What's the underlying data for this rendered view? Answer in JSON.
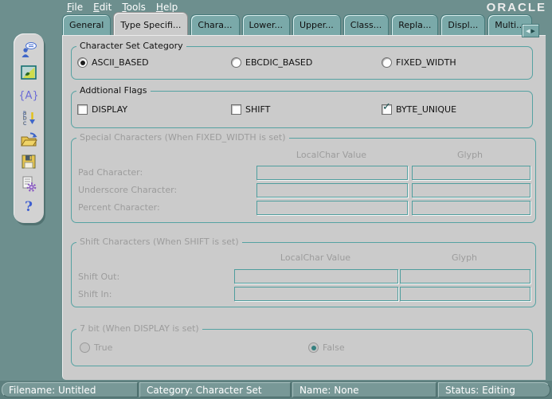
{
  "window": {
    "brand": "ORACLE"
  },
  "menu": {
    "items": [
      "File",
      "Edit",
      "Tools",
      "Help"
    ]
  },
  "tabs": [
    "General",
    "Type Specifi...",
    "Chara...",
    "Lower...",
    "Upper...",
    "Class...",
    "Repla...",
    "Displ...",
    "Multi..."
  ],
  "tab_scroll": {
    "left_arrow": "◀",
    "right_arrow": "▶"
  },
  "toolbar": {
    "icons": [
      "user-chat-icon",
      "image-icon",
      "braces-a-icon",
      "sort-abc-icon",
      "open-folder-icon",
      "save-icon",
      "settings-doc-icon",
      "help-icon"
    ]
  },
  "groups": {
    "charset_category": {
      "title": "Character Set Category",
      "options": [
        {
          "label": "ASCII_BASED",
          "selected": true
        },
        {
          "label": "EBCDIC_BASED",
          "selected": false
        },
        {
          "label": "FIXED_WIDTH",
          "selected": false
        }
      ]
    },
    "additional_flags": {
      "title": "Addtional Flags",
      "options": [
        {
          "label": "DISPLAY",
          "checked": false
        },
        {
          "label": "SHIFT",
          "checked": false
        },
        {
          "label": "BYTE_UNIQUE",
          "checked": true
        }
      ],
      "check_glyph": "✓"
    },
    "special_characters": {
      "title": "Special Characters (When FIXED_WIDTH is set)",
      "columns": [
        "LocalChar Value",
        "Glyph"
      ],
      "rows": [
        {
          "label": "Pad Character:",
          "localchar": "",
          "glyph": ""
        },
        {
          "label": "Underscore Character:",
          "localchar": "",
          "glyph": ""
        },
        {
          "label": "Percent Character:",
          "localchar": "",
          "glyph": ""
        }
      ],
      "disabled": true
    },
    "shift_characters": {
      "title": "Shift Characters (When SHIFT is set)",
      "columns": [
        "LocalChar Value",
        "Glyph"
      ],
      "rows": [
        {
          "label": "Shift Out:",
          "localchar": "",
          "glyph": ""
        },
        {
          "label": "Shift In:",
          "localchar": "",
          "glyph": ""
        }
      ],
      "disabled": true
    },
    "seven_bit": {
      "title": "7 bit (When DISPLAY is set)",
      "options": [
        {
          "label": "True",
          "selected": false
        },
        {
          "label": "False",
          "selected": true
        }
      ],
      "disabled": true
    }
  },
  "status_bar": {
    "segments": [
      "Filename: Untitled",
      "Category: Character Set",
      "Name: None",
      "Status: Editing"
    ]
  },
  "colors": {
    "window_bg": "#6d8f8e",
    "panel_bg": "#cbcbcb",
    "tab_bg": "#7aa9a9",
    "group_border": "#55a2a2",
    "field_border": "#4f9e9e",
    "check_mark": "#15504f",
    "disabled_text": "#9c9c9c",
    "status_text": "#ffffff",
    "brand_text": "#ececec"
  }
}
